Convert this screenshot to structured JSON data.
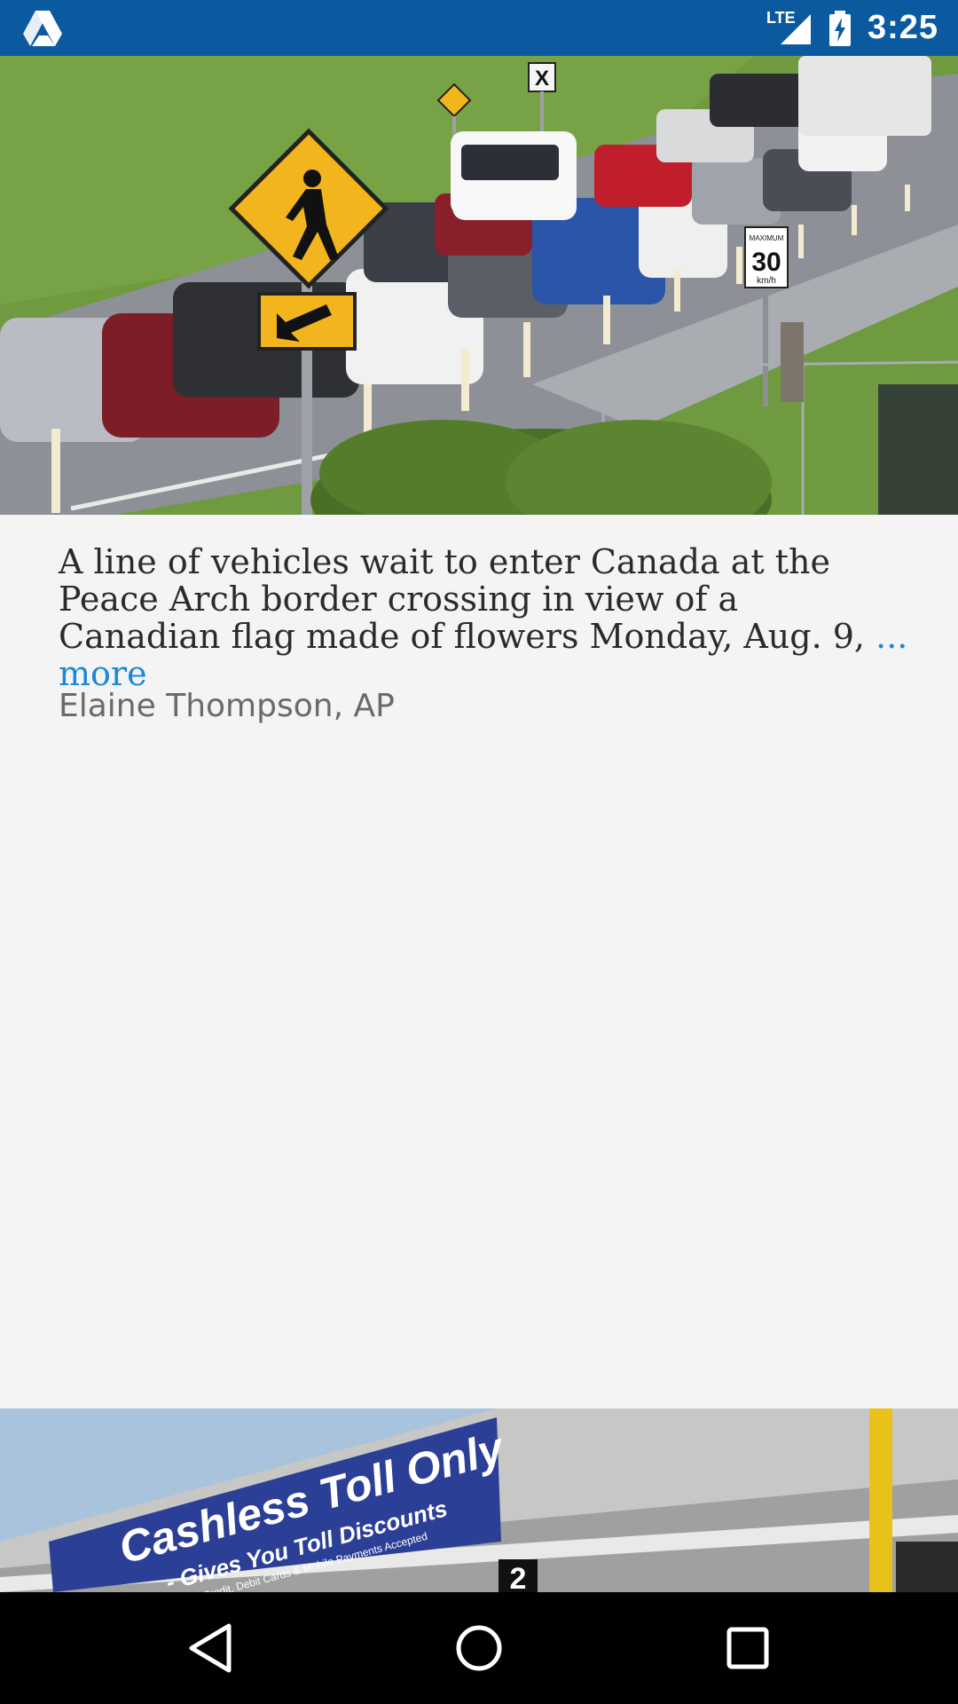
{
  "status_bar": {
    "time": "3:25",
    "network": "LTE",
    "icons": [
      "app-drive-icon",
      "signal-icon",
      "battery-charging-icon"
    ],
    "background": "#0b5aa0"
  },
  "gallery": {
    "caption": {
      "text": "A line of vehicles wait to enter Canada at the Peace Arch border crossing in view of a Canadian flag made of flowers Monday, Aug. 9,",
      "more_label": "... more",
      "credit": "Elaine Thompson, AP"
    },
    "photo1_signs": {
      "speed_top": "MAXIMUM",
      "speed_value": "30",
      "speed_unit": "km/h"
    },
    "photo2_banner": {
      "title": "Cashless Toll Only",
      "subtitle": "- Gives You Toll Discounts",
      "small": "Credit, Debit Cards & Mobile Payments Accepted",
      "lane_number": "2"
    }
  },
  "nav_bar": {
    "back": "back-icon",
    "home": "home-icon",
    "recents": "recents-icon"
  },
  "colors": {
    "link": "#1a88d8",
    "caption_text": "#2b2b2b",
    "credit_text": "#6a6a6a"
  }
}
